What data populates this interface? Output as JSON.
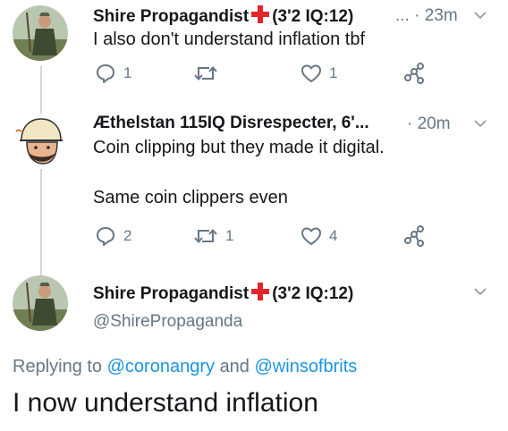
{
  "tweets": [
    {
      "name": "Shire Propagandist",
      "name_suffix": "(3'2 IQ:12)",
      "ellipsis": "...",
      "time": "· 23m",
      "text": "I also don't understand inflation tbf",
      "replies": "1",
      "retweets": "",
      "likes": "1"
    },
    {
      "name": "Æthelstan 115IQ Disrespecter, 6'...",
      "time": "· 20m",
      "text_line1": "Coin clipping but they made it digital.",
      "text_line2": "Same coin clippers even",
      "replies": "2",
      "retweets": "1",
      "likes": "4"
    }
  ],
  "main_tweet": {
    "name": "Shire Propagandist",
    "name_suffix": "(3'2 IQ:12)",
    "handle": "@ShirePropaganda",
    "replying_prefix": "Replying to",
    "mention_1": "@coronangry",
    "and_word": "and",
    "mention_2": "@winsofbrits",
    "text": "I now understand inflation"
  },
  "colors": {
    "accent": "#1b95e0",
    "muted": "#657786",
    "flag_red": "#e0262b"
  },
  "icons": [
    "reply-icon",
    "retweet-icon",
    "like-icon",
    "share-icon",
    "chevron-down-icon",
    "st-george-cross-icon"
  ]
}
